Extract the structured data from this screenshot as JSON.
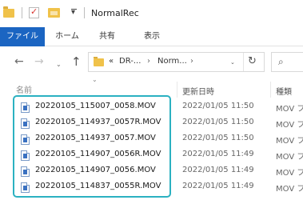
{
  "window": {
    "title": "NormalRec"
  },
  "quick_access": {
    "icons": [
      "folder-icon",
      "properties-check-icon",
      "new-folder-icon",
      "customize-dropdown-icon"
    ],
    "dropdown_glyph": "▾"
  },
  "ribbon": {
    "tabs": [
      {
        "label": "ファイル",
        "active": true
      },
      {
        "label": "ホーム"
      },
      {
        "label": "共有"
      },
      {
        "label": "表示"
      }
    ],
    "accent_color": "#1b65c2"
  },
  "nav": {
    "back_glyph": "←",
    "forward_glyph": "→",
    "recent_glyph": "⌄",
    "up_glyph": "↑",
    "refresh_glyph": "↻",
    "search_glyph": "⌕"
  },
  "address": {
    "overflow": "«",
    "crumbs": [
      "DR-...",
      "Norm..."
    ],
    "separator": "›",
    "dropdown_glyph": "⌄"
  },
  "columns": {
    "sort_glyph": "⌄",
    "name": "名前",
    "date": "更新日時",
    "type": "種類"
  },
  "files": [
    {
      "name": "20220105_115007_0058.MOV",
      "date": "2022/01/05 11:50",
      "type": "MOV フ"
    },
    {
      "name": "20220105_114937_0057R.MOV",
      "date": "2022/01/05 11:50",
      "type": "MOV フ"
    },
    {
      "name": "20220105_114937_0057.MOV",
      "date": "2022/01/05 11:50",
      "type": "MOV フ"
    },
    {
      "name": "20220105_114907_0056R.MOV",
      "date": "2022/01/05 11:49",
      "type": "MOV フ"
    },
    {
      "name": "20220105_114907_0056.MOV",
      "date": "2022/01/05 11:49",
      "type": "MOV フ"
    },
    {
      "name": "20220105_114837_0055R.MOV",
      "date": "2022/01/05 11:49",
      "type": "MOV フ"
    }
  ],
  "highlight_color": "#2bb1c1"
}
